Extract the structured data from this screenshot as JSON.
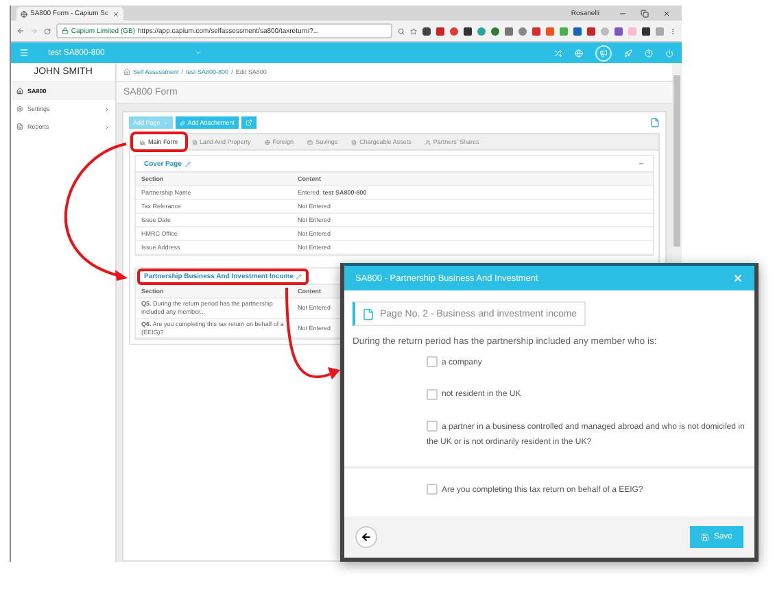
{
  "browser": {
    "tab_title": "SA800 Form - Capium Sc",
    "profile": "Rosanelli",
    "site_name": "Capium Limited (GB)",
    "url": "https://app.capium.com/selfassessment/sa800/taxreturn/?..."
  },
  "app_header": {
    "title": "test SA800-800"
  },
  "sidebar": {
    "user": "JOHN SMITH",
    "items": [
      {
        "label": "SA800",
        "kind": "home",
        "selected": true,
        "has_submenu": false
      },
      {
        "label": "Settings",
        "kind": "settings",
        "selected": false,
        "has_submenu": true
      },
      {
        "label": "Reports",
        "kind": "reports",
        "selected": false,
        "has_submenu": true
      }
    ]
  },
  "breadcrumb": [
    {
      "kind": "link",
      "text": "Self Assessment"
    },
    {
      "kind": "separator",
      "text": "/"
    },
    {
      "kind": "link",
      "text": "test SA800-800"
    },
    {
      "kind": "separator",
      "text": "/"
    },
    {
      "kind": "current",
      "text": "Edit SA800"
    }
  ],
  "page_title": "SA800 Form",
  "toolbar": [
    {
      "label": "Add Page",
      "kind": "dropdown",
      "disabled": true
    },
    {
      "label": "Add Attachement",
      "kind": "attach",
      "disabled": false
    },
    {
      "kind": "edit",
      "disabled": false
    }
  ],
  "tabs": [
    {
      "label": "Main Form",
      "selected": true,
      "highlighted": true
    },
    {
      "label": "Land And Property",
      "selected": false,
      "highlighted": false
    },
    {
      "label": "Foreign",
      "selected": false,
      "highlighted": false
    },
    {
      "label": "Savings",
      "selected": false,
      "highlighted": false
    },
    {
      "label": "Chargeable Assets",
      "selected": false,
      "highlighted": false
    },
    {
      "label": "Partners' Shares",
      "selected": false,
      "highlighted": false
    }
  ],
  "sections": [
    {
      "title": "Cover Page",
      "highlighted": false,
      "columns": [
        "Section",
        "Content"
      ],
      "rows": [
        {
          "section": "Partnership Name",
          "content": "Entered: **test SA800-800**"
        },
        {
          "section": "Tax Referance",
          "content": "Not Entered"
        },
        {
          "section": "Issue Date",
          "content": "Not Entered"
        },
        {
          "section": "HMRC Office",
          "content": "Not Entered"
        },
        {
          "section": "Issue Address",
          "content": "Not Entered"
        }
      ]
    },
    {
      "title": "Partnership Business And Investment Income",
      "highlighted": true,
      "columns": [
        "Section",
        "Content"
      ],
      "rows": [
        {
          "section": "**Q5.** During the return period has the partnership included any member...",
          "content": "Not Entered"
        },
        {
          "section": "**Q6.** Are you completing this tax return on behalf of a (EEIG)?",
          "content": "Not Entered"
        }
      ]
    }
  ],
  "dialog": {
    "title": "SA800 - Partnership Business And Investment",
    "page_label": "Page No. 2 - Business and investment income",
    "question": "During the return period has the partnership included any member who is:",
    "options": [
      {
        "label": "a company",
        "checked": false
      },
      {
        "label": "not resident in the UK",
        "checked": false
      },
      {
        "label": "a partner in a business controlled and managed abroad and who is not domiciled in the UK or is not ordinarily resident in the UK?",
        "checked": false
      }
    ],
    "eeig_question": {
      "label": "Are you completing this tax return on behalf of a EEIG?",
      "checked": false
    },
    "save_label": "Save"
  }
}
